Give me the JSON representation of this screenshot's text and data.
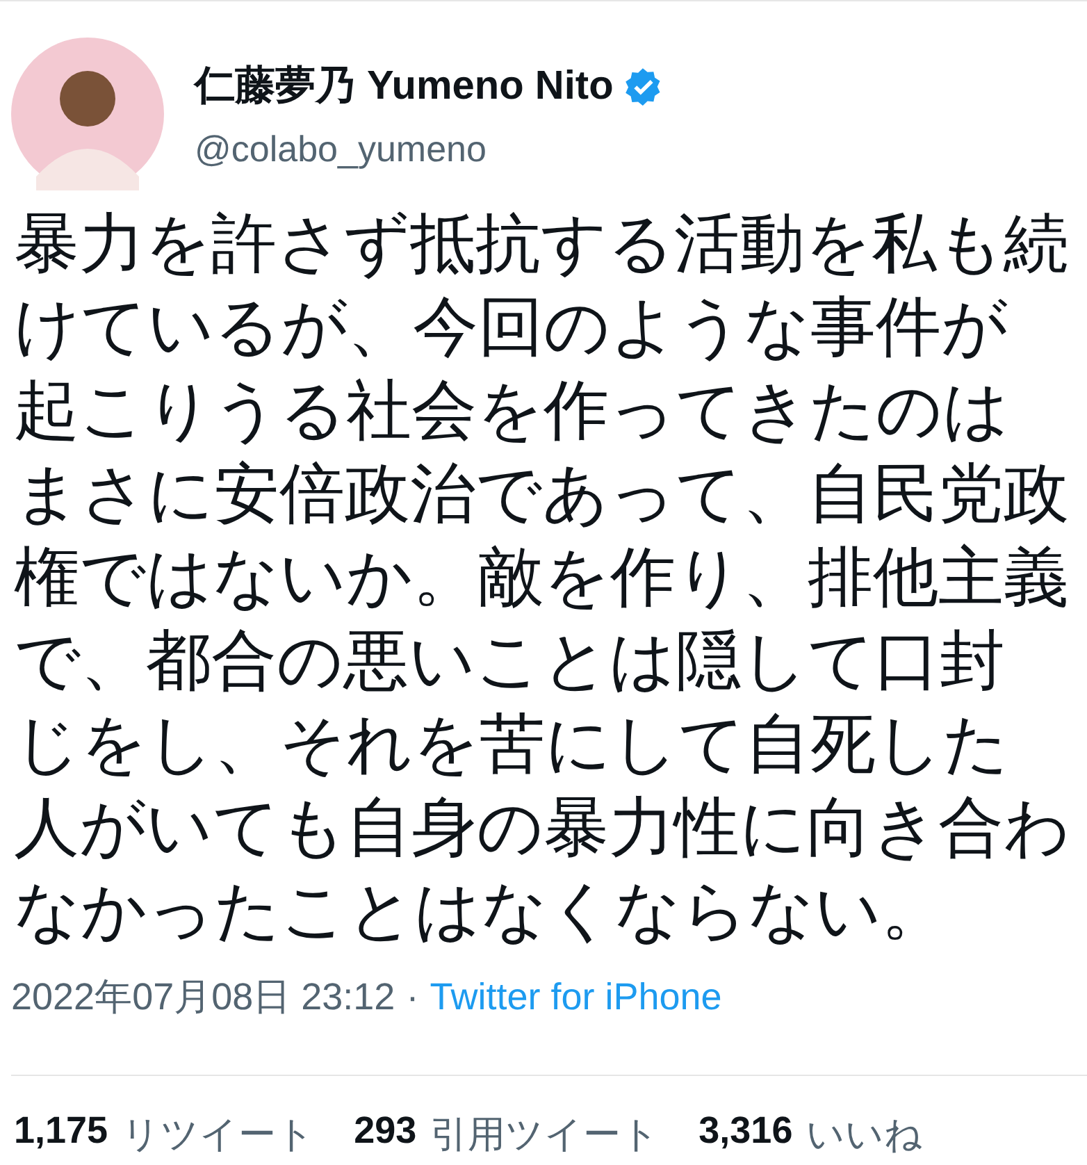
{
  "author": {
    "name": "仁藤夢乃 Yumeno Nito",
    "verified": true,
    "handle": "@colabo_yumeno"
  },
  "tweet": {
    "text": "暴力を許さず抵抗する活動を私も続けているが、今回のような事件が起こりうる社会を作ってきたのはまさに安倍政治であって、自民党政権ではないか。敵を作り、排他主義で、都合の悪いことは隠して口封じをし、それを苦にして自死した人がいても自身の暴力性に向き合わなかったことはなくならない。"
  },
  "meta": {
    "timestamp": "2022年07月08日 23:12",
    "separator": "·",
    "source": "Twitter for iPhone"
  },
  "stats": [
    {
      "count": "1,175",
      "label": "リツイート"
    },
    {
      "count": "293",
      "label": "引用ツイート"
    },
    {
      "count": "3,316",
      "label": "いいね"
    }
  ]
}
